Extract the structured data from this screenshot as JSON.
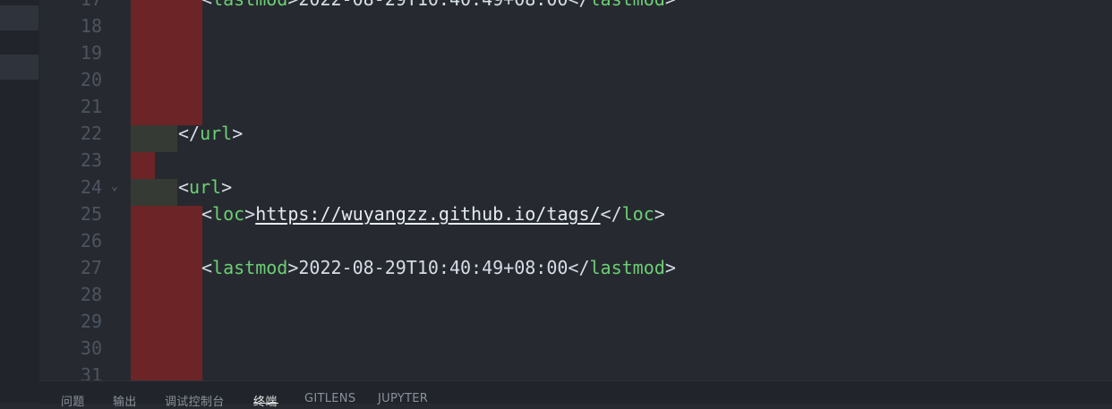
{
  "editor": {
    "lines": [
      {
        "num": "17",
        "parts": [
          {
            "c": "br",
            "t": "<"
          },
          {
            "c": "tag",
            "t": "lastmod"
          },
          {
            "c": "br",
            "t": ">"
          },
          {
            "c": "txt",
            "t": "2022-08-29T10:40:49+08:00"
          },
          {
            "c": "br",
            "t": "</"
          },
          {
            "c": "tag",
            "t": "lastmod"
          },
          {
            "c": "br",
            "t": ">"
          }
        ]
      },
      {
        "num": "18",
        "parts": []
      },
      {
        "num": "19",
        "parts": []
      },
      {
        "num": "20",
        "parts": []
      },
      {
        "num": "21",
        "parts": []
      },
      {
        "num": "22",
        "parts": [
          {
            "c": "br",
            "t": "</"
          },
          {
            "c": "tag",
            "t": "url"
          },
          {
            "c": "br",
            "t": ">"
          }
        ]
      },
      {
        "num": "23",
        "parts": []
      },
      {
        "num": "24",
        "parts": [
          {
            "c": "br",
            "t": "<"
          },
          {
            "c": "tag",
            "t": "url"
          },
          {
            "c": "br",
            "t": ">"
          }
        ]
      },
      {
        "num": "25",
        "parts": [
          {
            "c": "br",
            "t": "<"
          },
          {
            "c": "tag",
            "t": "loc"
          },
          {
            "c": "br",
            "t": ">"
          },
          {
            "c": "link",
            "t": "https://wuyangzz.github.io/tags/"
          },
          {
            "c": "br",
            "t": "</"
          },
          {
            "c": "tag",
            "t": "loc"
          },
          {
            "c": "br",
            "t": ">"
          }
        ]
      },
      {
        "num": "26",
        "parts": []
      },
      {
        "num": "27",
        "parts": [
          {
            "c": "br",
            "t": "<"
          },
          {
            "c": "tag",
            "t": "lastmod"
          },
          {
            "c": "br",
            "t": ">"
          },
          {
            "c": "txt",
            "t": "2022-08-29T10:40:49+08:00"
          },
          {
            "c": "br",
            "t": "</"
          },
          {
            "c": "tag",
            "t": "lastmod"
          },
          {
            "c": "br",
            "t": ">"
          }
        ]
      },
      {
        "num": "28",
        "parts": []
      },
      {
        "num": "29",
        "parts": []
      },
      {
        "num": "30",
        "parts": []
      },
      {
        "num": "31",
        "parts": []
      }
    ],
    "fold_icon": "chevron-down-icon"
  },
  "panel": {
    "tabs": [
      {
        "label": "问题",
        "active": false
      },
      {
        "label": "输出",
        "active": false
      },
      {
        "label": "调试控制台",
        "active": false
      },
      {
        "label": "终端",
        "active": true
      },
      {
        "label": "GITLENS",
        "active": false
      },
      {
        "label": "JUPYTER",
        "active": false
      }
    ]
  },
  "colors": {
    "background": "#262a30",
    "tag": "#6ccf74",
    "diff_removed": "#6c2426",
    "diff_block": "#353a34"
  }
}
